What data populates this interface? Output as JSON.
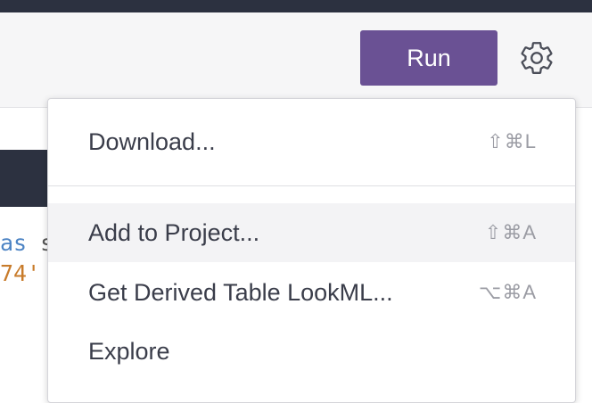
{
  "toolbar": {
    "run_label": "Run",
    "settings_icon": "gear-icon"
  },
  "code": {
    "line1_keyword": "as",
    "line1_rest": " s",
    "line2": "74'"
  },
  "menu": {
    "items": [
      {
        "label": "Download...",
        "shortcut": "⇧⌘L",
        "highlighted": false
      },
      {
        "label": "Add to Project...",
        "shortcut": "⇧⌘A",
        "highlighted": true
      },
      {
        "label": "Get Derived Table LookML...",
        "shortcut": "⌥⌘A",
        "highlighted": false
      },
      {
        "label": "Explore",
        "shortcut": "",
        "highlighted": false
      }
    ]
  },
  "colors": {
    "topbar": "#2c3140",
    "run_button": "#6a5194",
    "menu_highlight": "#f3f3f5",
    "keyword": "#4d84c4",
    "string": "#c87b2a"
  }
}
